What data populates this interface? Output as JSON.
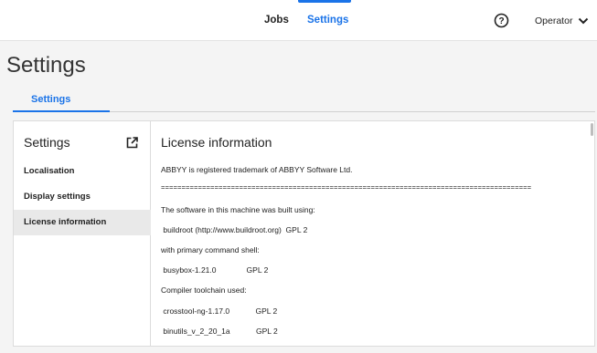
{
  "header": {
    "nav": [
      {
        "label": "Jobs"
      },
      {
        "label": "Settings",
        "active": true
      }
    ],
    "help_icon": "question-circle-icon",
    "user_label": "Operator",
    "user_menu_icon": "chevron-down-icon",
    "accent_color": "#1a73e8"
  },
  "page": {
    "title": "Settings",
    "tabs": [
      {
        "label": "Settings",
        "active": true
      }
    ]
  },
  "sidebar": {
    "title": "Settings",
    "external_icon": "open-external-icon",
    "items": [
      {
        "label": "Localisation"
      },
      {
        "label": "Display settings"
      },
      {
        "label": "License information",
        "active": true
      }
    ]
  },
  "content": {
    "title": "License information",
    "lines": [
      "ABBYY is registered trademark of ABBYY Software Ltd.",
      "==========================================================================================",
      "The software in this machine was built using:",
      " buildroot (http://www.buildroot.org)  GPL 2",
      "with primary command shell:",
      " busybox-1.21.0              GPL 2",
      "Compiler toolchain used:",
      " crosstool-ng-1.17.0            GPL 2",
      " binutils_v_2_20_1a            GPL 2"
    ]
  }
}
